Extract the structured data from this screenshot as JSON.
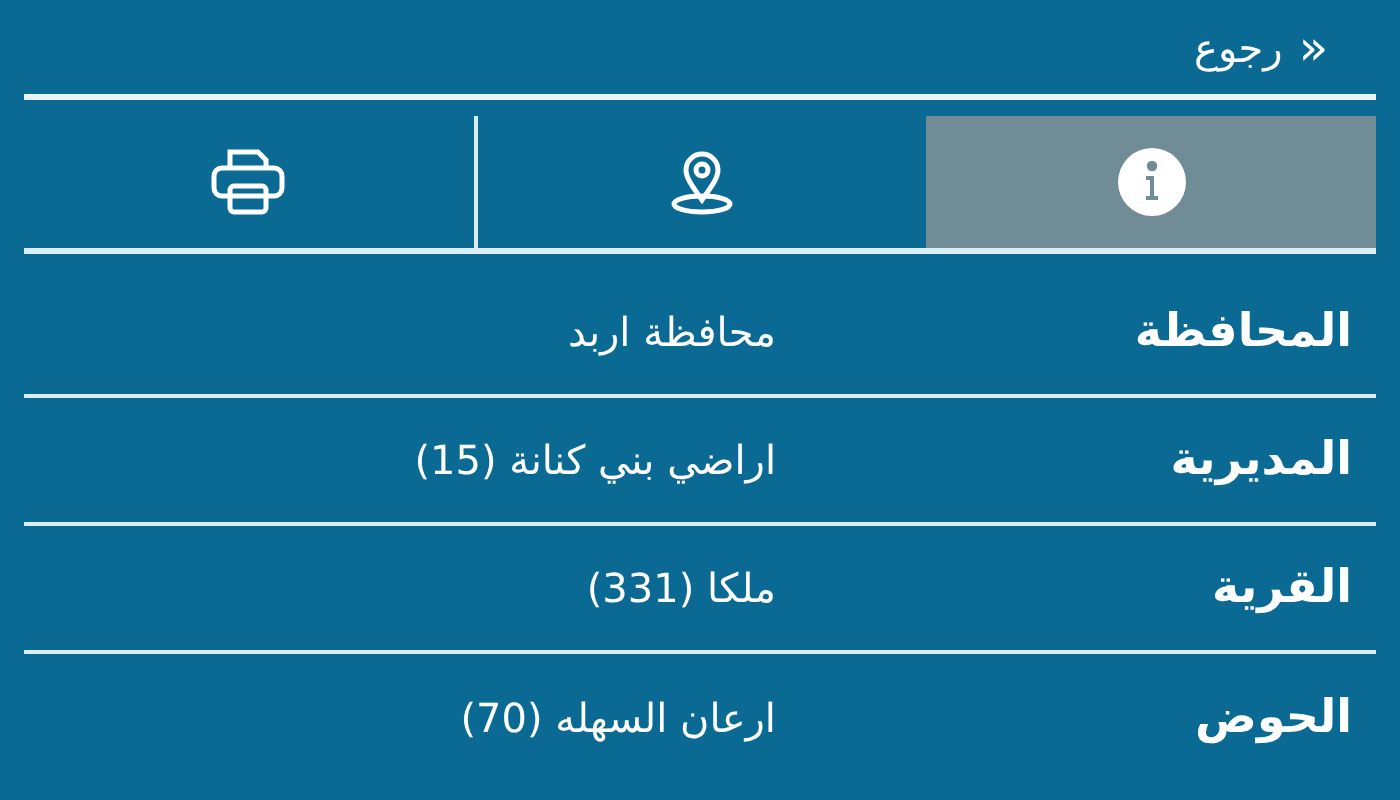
{
  "back": {
    "icon": "«",
    "label": "رجوع"
  },
  "tabs": [
    {
      "kind": "info",
      "selected": true
    },
    {
      "kind": "location",
      "selected": false
    },
    {
      "kind": "print",
      "selected": false
    }
  ],
  "fields": [
    {
      "label": "المحافظة",
      "value": "محافظة اربد"
    },
    {
      "label": "المديرية",
      "value": "اراضي بني كنانة (15)"
    },
    {
      "label": "القرية",
      "value": "ملكا (331)"
    },
    {
      "label": "الحوض",
      "value": "ارعان السهله (70)"
    }
  ]
}
